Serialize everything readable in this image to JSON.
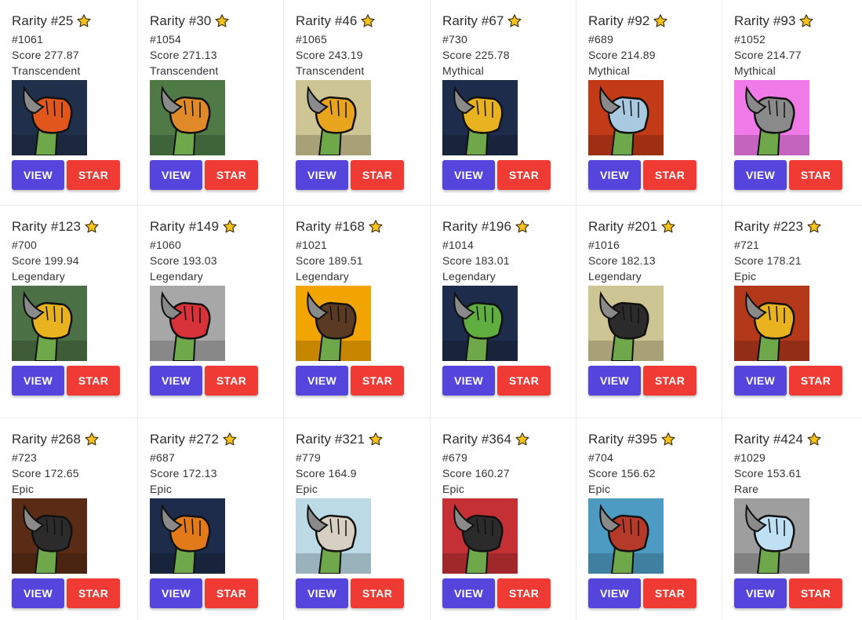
{
  "labels": {
    "view": "VIEW",
    "star": "STAR"
  },
  "cards": [
    {
      "rarity": "Rarity #25",
      "id": "#1061",
      "score": "Score 277.87",
      "tier": "Transcendent",
      "bg": "#20304a",
      "accent": "#e0561b"
    },
    {
      "rarity": "Rarity #30",
      "id": "#1054",
      "score": "Score 271.13",
      "tier": "Transcendent",
      "bg": "#4f7a46",
      "accent": "#e08a2a"
    },
    {
      "rarity": "Rarity #46",
      "id": "#1065",
      "score": "Score 243.19",
      "tier": "Transcendent",
      "bg": "#cdc593",
      "accent": "#e9a41e"
    },
    {
      "rarity": "Rarity #67",
      "id": "#730",
      "score": "Score 225.78",
      "tier": "Mythical",
      "bg": "#1d2c4a",
      "accent": "#e9b320"
    },
    {
      "rarity": "Rarity #92",
      "id": "#689",
      "score": "Score 214.89",
      "tier": "Mythical",
      "bg": "#c23a16",
      "accent": "#a8c9e0"
    },
    {
      "rarity": "Rarity #93",
      "id": "#1052",
      "score": "Score 214.77",
      "tier": "Mythical",
      "bg": "#ef7ae8",
      "accent": "#8a8a8a"
    },
    {
      "rarity": "Rarity #123",
      "id": "#700",
      "score": "Score 199.94",
      "tier": "Legendary",
      "bg": "#4d7146",
      "accent": "#e9b320"
    },
    {
      "rarity": "Rarity #149",
      "id": "#1060",
      "score": "Score 193.03",
      "tier": "Legendary",
      "bg": "#a7a7a7",
      "accent": "#d8323a"
    },
    {
      "rarity": "Rarity #168",
      "id": "#1021",
      "score": "Score 189.51",
      "tier": "Legendary",
      "bg": "#f2a400",
      "accent": "#5a3a22"
    },
    {
      "rarity": "Rarity #196",
      "id": "#1014",
      "score": "Score 183.01",
      "tier": "Legendary",
      "bg": "#1d2c4a",
      "accent": "#5fae3f"
    },
    {
      "rarity": "Rarity #201",
      "id": "#1016",
      "score": "Score 182.13",
      "tier": "Legendary",
      "bg": "#cdc593",
      "accent": "#2b2b2b"
    },
    {
      "rarity": "Rarity #223",
      "id": "#721",
      "score": "Score 178.21",
      "tier": "Epic",
      "bg": "#b3391a",
      "accent": "#e9b320"
    },
    {
      "rarity": "Rarity #268",
      "id": "#723",
      "score": "Score 172.65",
      "tier": "Epic",
      "bg": "#5a2c15",
      "accent": "#2b2b2b"
    },
    {
      "rarity": "Rarity #272",
      "id": "#687",
      "score": "Score 172.13",
      "tier": "Epic",
      "bg": "#1d2c4a",
      "accent": "#e27a1a"
    },
    {
      "rarity": "Rarity #321",
      "id": "#779",
      "score": "Score 164.9",
      "tier": "Epic",
      "bg": "#bcd9e6",
      "accent": "#d6cfc2"
    },
    {
      "rarity": "Rarity #364",
      "id": "#679",
      "score": "Score 160.27",
      "tier": "Epic",
      "bg": "#c43034",
      "accent": "#2b2b2b"
    },
    {
      "rarity": "Rarity #395",
      "id": "#704",
      "score": "Score 156.62",
      "tier": "Epic",
      "bg": "#4d9bc3",
      "accent": "#b53a2a"
    },
    {
      "rarity": "Rarity #424",
      "id": "#1029",
      "score": "Score 153.61",
      "tier": "Rare",
      "bg": "#9e9e9e",
      "accent": "#bfe0f2"
    }
  ],
  "icons": {
    "star": "star-icon",
    "nft": "hand-artwork-image"
  },
  "colors": {
    "view_button": "#5545dc",
    "star_button": "#ef3b33",
    "star_icon": "#f7c21b"
  }
}
